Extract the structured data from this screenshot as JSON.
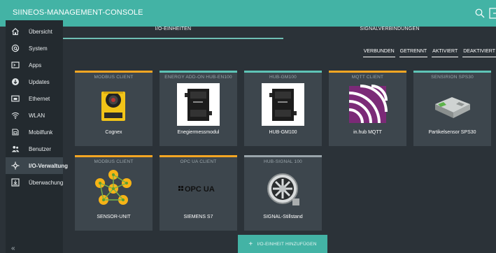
{
  "app": {
    "title": "SIINEOS-MANAGEMENT-CONSOLE"
  },
  "colors": {
    "accent": "#43b3a5",
    "sidebar": "#232a2f",
    "background": "#2b3238",
    "card": "#3d464d",
    "orange": "#f5a623",
    "teal": "#5ec4b6",
    "grey": "#9aa5ab",
    "purple": "#7b2a77"
  },
  "sidebar": {
    "items": [
      {
        "label": "Übersicht",
        "icon": "home-icon"
      },
      {
        "label": "System",
        "icon": "system-icon"
      },
      {
        "label": "Apps",
        "icon": "apps-icon"
      },
      {
        "label": "Updates",
        "icon": "updates-icon"
      },
      {
        "label": "Ethernet",
        "icon": "ethernet-icon"
      },
      {
        "label": "WLAN",
        "icon": "wifi-icon"
      },
      {
        "label": "Mobilfunk",
        "icon": "mobile-icon"
      },
      {
        "label": "Benutzer",
        "icon": "users-icon"
      },
      {
        "label": "I/O-Verwaltung",
        "icon": "io-icon",
        "active": true
      },
      {
        "label": "Überwachung",
        "icon": "monitoring-icon"
      }
    ],
    "collapse": "«"
  },
  "tabs": [
    {
      "label": "I/O-EINHEITEN",
      "active": true
    },
    {
      "label": "SIGNALVERBINDUNGEN"
    }
  ],
  "filters": [
    "VERBUNDEN",
    "GETRENNT",
    "AKTIVIERT",
    "DEAKTIVIERT"
  ],
  "cards": [
    {
      "type": "MODBUS CLIENT",
      "name": "Cognex",
      "status": "orange",
      "image": "camera-image"
    },
    {
      "type": "ENERGY ADD-ON HUB-EN100",
      "name": "Enegiermessmodul",
      "status": "teal",
      "image": "module-image"
    },
    {
      "type": "HUB-GM100",
      "name": "HUB-GM100",
      "status": "teal",
      "image": "module-image"
    },
    {
      "type": "MQTT CLIENT",
      "name": "in.hub MQTT",
      "status": "orange",
      "image": "mqtt-logo"
    },
    {
      "type": "SENSIRION SPS30",
      "name": "Partikelsensor SPS30",
      "status": "teal",
      "image": "sensor-image"
    },
    {
      "type": "MODBUS CLIENT",
      "name": "SENSOR-UNIT",
      "status": "orange",
      "image": "network-image"
    },
    {
      "type": "OPC UA CLIENT",
      "name": "SIEMENS S7",
      "status": "orange",
      "image": "opcua-logo",
      "logo_text": "OPC UA"
    },
    {
      "type": "HUB-SIGNAL 100",
      "name": "SIGNAL-Stillstand",
      "status": "grey",
      "image": "signal-image"
    }
  ],
  "add_button": {
    "label": "I/O-EINHEIT HINZUFÜGEN"
  }
}
